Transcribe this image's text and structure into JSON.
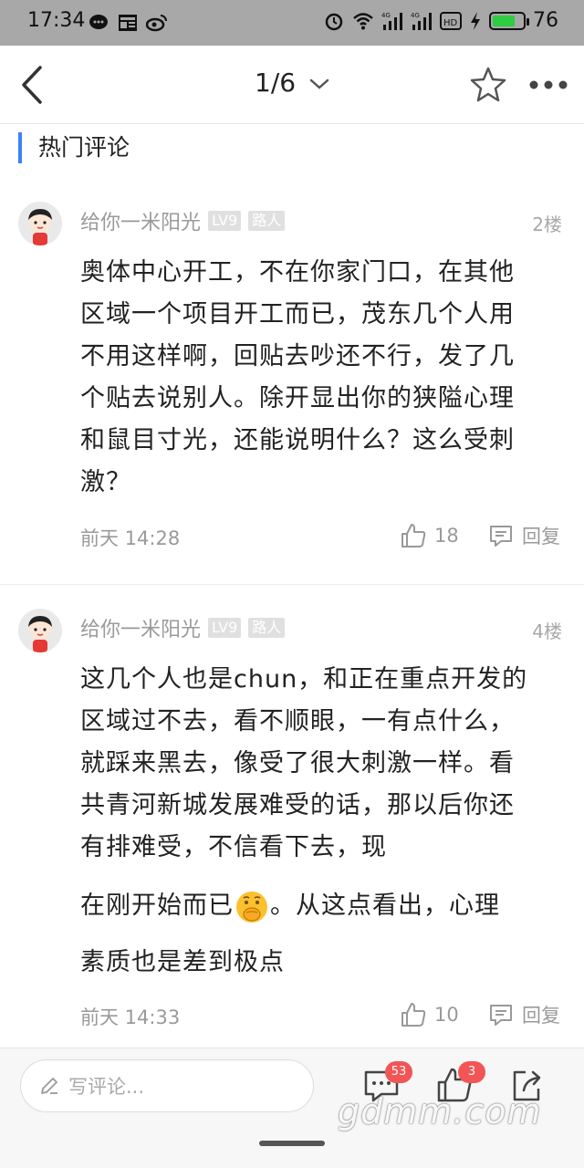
{
  "status_bar": {
    "time": "17:34",
    "battery": "76",
    "left_icons": [
      "message-icon",
      "news-icon",
      "weibo-icon"
    ],
    "right_icons": [
      "alarm-icon",
      "wifi-icon",
      "signal-4g-icon",
      "signal-4g-icon",
      "hd-icon",
      "charging-icon"
    ]
  },
  "nav": {
    "pager": "1/6"
  },
  "section": {
    "title": "热门评论"
  },
  "comments": [
    {
      "user": "给你一米阳光",
      "level": "LV9",
      "role": "路人",
      "floor": "2楼",
      "text": "奥体中心开工，不在你家门口，在其他区域一个项目开工而已，茂东几个人用不用这样啊，回贴去吵还不行，发了几个贴去说别人。除开显出你的狭隘心理和鼠目寸光，还能说明什么？这么受刺激？",
      "time": "前天 14:28",
      "likes": "18",
      "reply_label": "回复"
    },
    {
      "user": "给你一米阳光",
      "level": "LV9",
      "role": "路人",
      "floor": "4楼",
      "text_part1": "这几个人也是chun，和正在重点开发的区域过不去，看不顺眼，一有点什么，就踩来黑去，像受了很大刺激一样。看共青河新城发展难受的话，那以后你还有排难受，不信看下去，现",
      "text_line2": "在刚开始而已",
      "text_line2_after": "。从这点看出，心理",
      "text_line3": "素质也是差到极点",
      "time": "前天 14:33",
      "likes": "10",
      "reply_label": "回复"
    }
  ],
  "bottom_bar": {
    "input_placeholder": "写评论...",
    "comment_count": "53",
    "like_count": "3"
  },
  "watermark": "gdmm.com",
  "colors": {
    "accent": "#3b82f6",
    "badge_red": "#f25555",
    "status_bar_bg": "#a8a8a8"
  }
}
